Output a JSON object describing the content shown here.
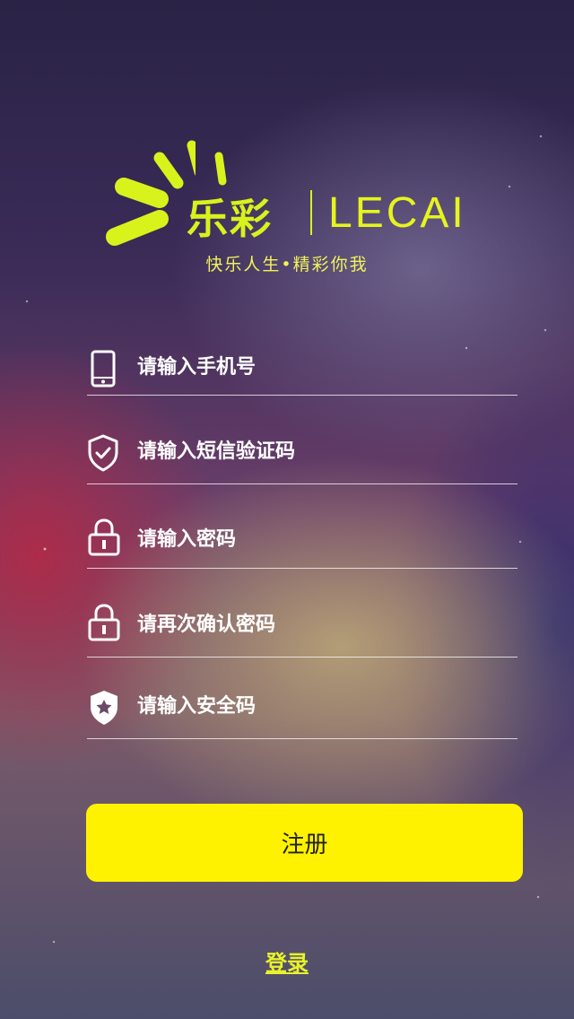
{
  "brand": {
    "name_cn": "乐彩",
    "name_en": "LECAI",
    "slogan": "快乐人生•精彩你我",
    "accent_color": "#d8f21c"
  },
  "form": {
    "fields": [
      {
        "placeholder": "请输入手机号",
        "icon": "phone-icon"
      },
      {
        "placeholder": "请输入短信验证码",
        "icon": "shield-check-icon"
      },
      {
        "placeholder": "请输入密码",
        "icon": "lock-icon"
      },
      {
        "placeholder": "请再次确认密码",
        "icon": "lock-icon"
      },
      {
        "placeholder": "请输入安全码",
        "icon": "shield-star-icon"
      }
    ]
  },
  "actions": {
    "register_label": "注册",
    "register_color": "#fff200",
    "login_label": "登录"
  }
}
